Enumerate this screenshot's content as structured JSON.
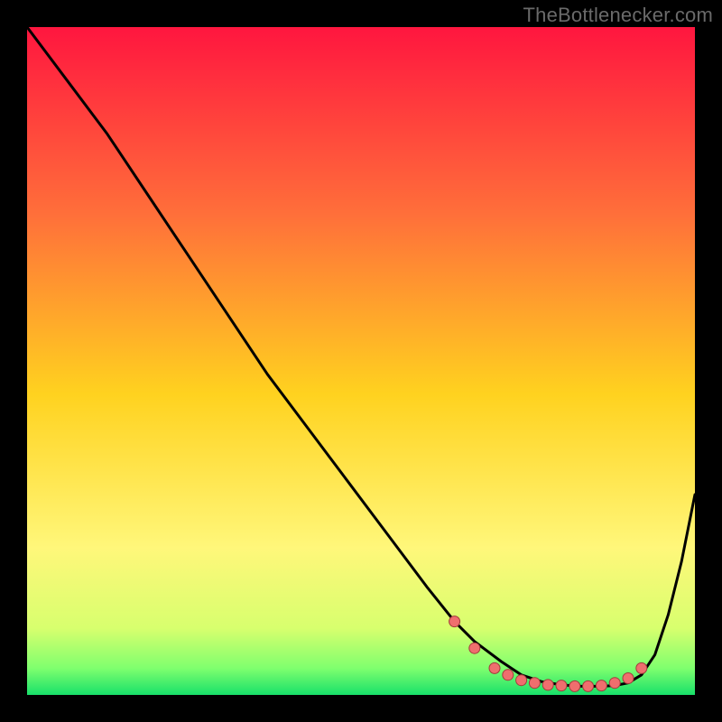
{
  "attribution": "TheBottlenecker.com",
  "colors": {
    "bg_black": "#000000",
    "grad_top": "#ff163f",
    "grad_mid_upper": "#ff6f3a",
    "grad_mid": "#ffd21f",
    "grad_low": "#fff77a",
    "grad_bottom1": "#d8ff6e",
    "grad_bottom2": "#7fff6e",
    "grad_bottom3": "#18e06a",
    "line": "#000000",
    "marker_fill": "#ef6e6e",
    "marker_stroke": "#a33c3c"
  },
  "chart_data": {
    "type": "line",
    "title": "",
    "xlabel": "",
    "ylabel": "",
    "xlim": [
      0,
      100
    ],
    "ylim": [
      0,
      100
    ],
    "series": [
      {
        "name": "curve",
        "x": [
          0,
          6,
          12,
          18,
          24,
          30,
          36,
          42,
          48,
          54,
          60,
          64,
          67,
          71,
          74,
          77,
          80,
          83,
          86,
          88,
          90,
          92,
          94,
          96,
          98,
          100
        ],
        "y": [
          100,
          92,
          84,
          75,
          66,
          57,
          48,
          40,
          32,
          24,
          16,
          11,
          8,
          5,
          3,
          2,
          1.5,
          1.3,
          1.3,
          1.4,
          1.8,
          3,
          6,
          12,
          20,
          30
        ]
      }
    ],
    "markers": {
      "name": "bottleneck-range",
      "x": [
        64,
        67,
        70,
        72,
        74,
        76,
        78,
        80,
        82,
        84,
        86,
        88,
        90,
        92
      ],
      "y": [
        11,
        7,
        4,
        3,
        2.2,
        1.8,
        1.5,
        1.4,
        1.3,
        1.3,
        1.4,
        1.8,
        2.5,
        4
      ]
    }
  }
}
